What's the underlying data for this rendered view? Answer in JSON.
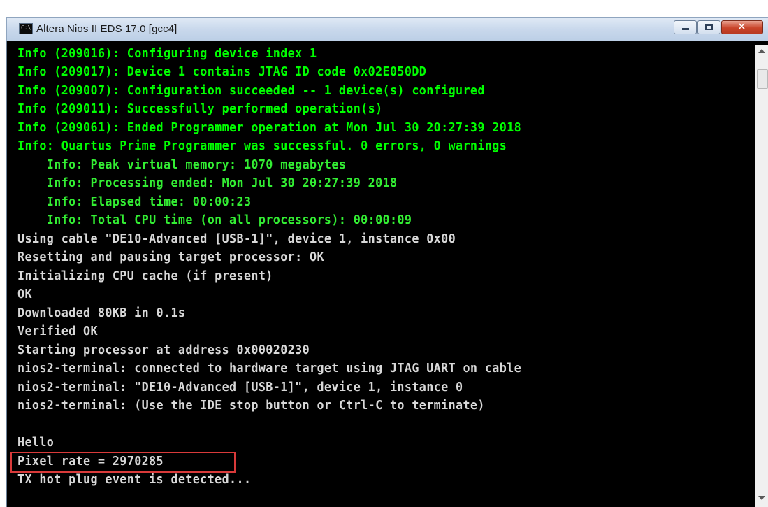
{
  "window": {
    "title": "Altera Nios II EDS 17.0 [gcc4]",
    "icon_label": "C:\\",
    "controls": [
      "minimize",
      "maximize",
      "close"
    ]
  },
  "console": {
    "lines": [
      {
        "text": "Info (209016): Configuring device index 1",
        "color": "#00ff00"
      },
      {
        "text": "Info (209017): Device 1 contains JTAG ID code 0x02E050DD",
        "color": "#00ff00"
      },
      {
        "text": "Info (209007): Configuration succeeded -- 1 device(s) configured",
        "color": "#00ff00"
      },
      {
        "text": "Info (209011): Successfully performed operation(s)",
        "color": "#00ff00"
      },
      {
        "text": "Info (209061): Ended Programmer operation at Mon Jul 30 20:27:39 2018",
        "color": "#00ff00"
      },
      {
        "text": "Info: Quartus Prime Programmer was successful. 0 errors, 0 warnings",
        "color": "#00ff00"
      },
      {
        "text": "    Info: Peak virtual memory: 1070 megabytes",
        "color": "#33ee33"
      },
      {
        "text": "    Info: Processing ended: Mon Jul 30 20:27:39 2018",
        "color": "#33ee33"
      },
      {
        "text": "    Info: Elapsed time: 00:00:23",
        "color": "#33ee33"
      },
      {
        "text": "    Info: Total CPU time (on all processors): 00:00:09",
        "color": "#33ee33"
      },
      {
        "text": "Using cable \"DE10-Advanced [USB-1]\", device 1, instance 0x00",
        "color": "#d8d8d8"
      },
      {
        "text": "Resetting and pausing target processor: OK",
        "color": "#d8d8d8"
      },
      {
        "text": "Initializing CPU cache (if present)",
        "color": "#d8d8d8"
      },
      {
        "text": "OK",
        "color": "#d8d8d8"
      },
      {
        "text": "Downloaded 80KB in 0.1s",
        "color": "#d8d8d8"
      },
      {
        "text": "Verified OK",
        "color": "#d8d8d8"
      },
      {
        "text": "Starting processor at address 0x00020230",
        "color": "#d8d8d8"
      },
      {
        "text": "nios2-terminal: connected to hardware target using JTAG UART on cable",
        "color": "#d8d8d8"
      },
      {
        "text": "nios2-terminal: \"DE10-Advanced [USB-1]\", device 1, instance 0",
        "color": "#d8d8d8"
      },
      {
        "text": "nios2-terminal: (Use the IDE stop button or Ctrl-C to terminate)",
        "color": "#d8d8d8"
      },
      {
        "text": "",
        "color": "#d8d8d8"
      },
      {
        "text": "Hello",
        "color": "#d8d8d8"
      },
      {
        "text": "Pixel rate = 2970285",
        "color": "#d8d8d8",
        "highlighted": true
      },
      {
        "text": "TX hot plug event is detected...",
        "color": "#d8d8d8"
      }
    ]
  },
  "highlight": {
    "border_color": "#d93a3a"
  }
}
